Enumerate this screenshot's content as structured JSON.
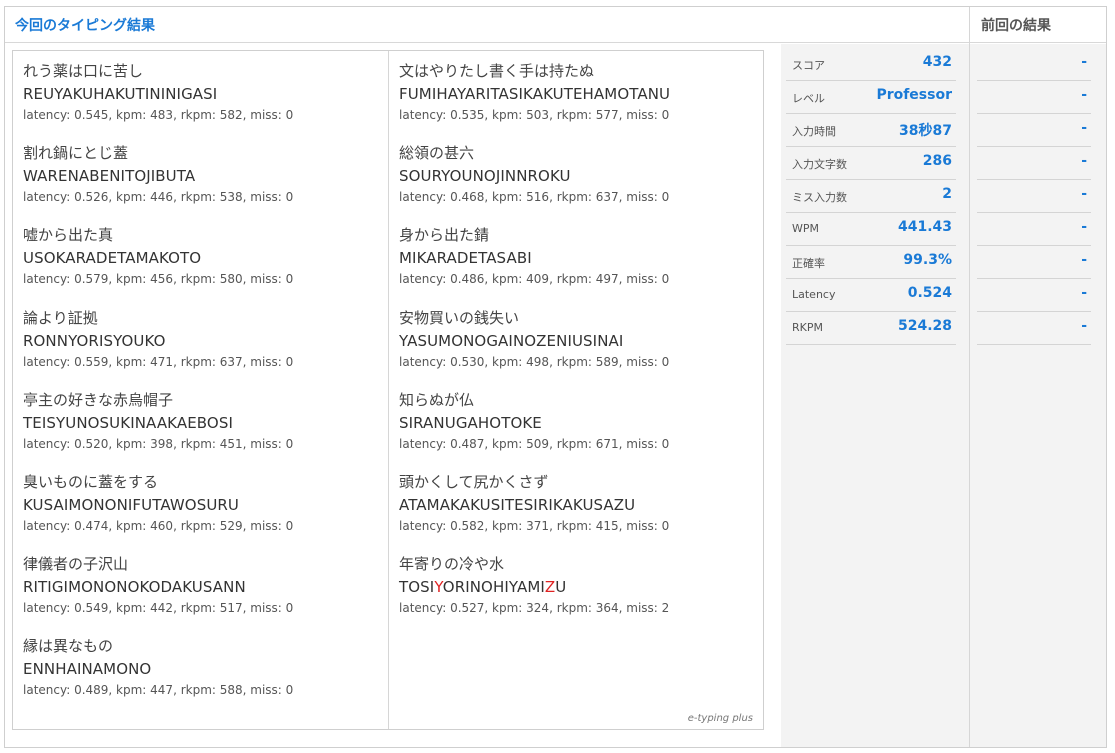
{
  "header": {
    "title": "今回のタイピング結果",
    "previous_title": "前回の結果"
  },
  "brand": "e-typing plus",
  "words": [
    {
      "jp": "れう薬は口に苦し",
      "romaji": "REUYAKUHAKUTININIGASI",
      "metric": "latency: 0.545, kpm: 483, rkpm: 582, miss: 0"
    },
    {
      "jp": "割れ鍋にとじ蓋",
      "romaji": "WARENABENITOJIBUTA",
      "metric": "latency: 0.526, kpm: 446, rkpm: 538, miss: 0"
    },
    {
      "jp": "嘘から出た真",
      "romaji": "USOKARADETAMAKOTO",
      "metric": "latency: 0.579, kpm: 456, rkpm: 580, miss: 0"
    },
    {
      "jp": "論より証拠",
      "romaji": "RONNYORISYOUKO",
      "metric": "latency: 0.559, kpm: 471, rkpm: 637, miss: 0"
    },
    {
      "jp": "亭主の好きな赤烏帽子",
      "romaji": "TEISYUNOSUKINAAKAEBOSI",
      "metric": "latency: 0.520, kpm: 398, rkpm: 451, miss: 0"
    },
    {
      "jp": "臭いものに蓋をする",
      "romaji": "KUSAIMONONIFUTAWOSURU",
      "metric": "latency: 0.474, kpm: 460, rkpm: 529, miss: 0"
    },
    {
      "jp": "律儀者の子沢山",
      "romaji": "RITIGIMONONOKODAKUSANN",
      "metric": "latency: 0.549, kpm: 442, rkpm: 517, miss: 0"
    },
    {
      "jp": "縁は異なもの",
      "romaji": "ENNHAINAMONO",
      "metric": "latency: 0.489, kpm: 447, rkpm: 588, miss: 0"
    },
    {
      "jp": "文はやりたし書く手は持たぬ",
      "romaji": "FUMIHAYARITASIKAKUTEHAMOTANU",
      "metric": "latency: 0.535, kpm: 503, rkpm: 577, miss: 0"
    },
    {
      "jp": "総領の甚六",
      "romaji": "SOURYOUNOJINNROKU",
      "metric": "latency: 0.468, kpm: 516, rkpm: 637, miss: 0"
    },
    {
      "jp": "身から出た錆",
      "romaji": "MIKARADETASABI",
      "metric": "latency: 0.486, kpm: 409, rkpm: 497, miss: 0"
    },
    {
      "jp": "安物買いの銭失い",
      "romaji": "YASUMONOGAINOZENIUSINAI",
      "metric": "latency: 0.530, kpm: 498, rkpm: 589, miss: 0"
    },
    {
      "jp": "知らぬが仏",
      "romaji": "SIRANUGAHOTOKE",
      "metric": "latency: 0.487, kpm: 509, rkpm: 671, miss: 0"
    },
    {
      "jp": "頭かくして尻かくさず",
      "romaji": "ATAMAKAKUSITESIRIKAKUSAZU",
      "metric": "latency: 0.582, kpm: 371, rkpm: 415, miss: 0"
    },
    {
      "jp": "年寄りの冷や水",
      "romaji_parts": [
        "TOSI",
        "Y",
        "ORINOHIYAMI",
        "Z",
        "U"
      ],
      "metric": "latency: 0.527, kpm: 324, rkpm: 364, miss: 2"
    }
  ],
  "stats": [
    {
      "label": "スコア",
      "value": "432"
    },
    {
      "label": "レベル",
      "value": "Professor"
    },
    {
      "label": "入力時間",
      "value": "38秒87"
    },
    {
      "label": "入力文字数",
      "value": "286"
    },
    {
      "label": "ミス入力数",
      "value": "2"
    },
    {
      "label": "WPM",
      "value": "441.43"
    },
    {
      "label": "正確率",
      "value": "99.3%"
    },
    {
      "label": "Latency",
      "value": "0.524"
    },
    {
      "label": "RKPM",
      "value": "524.28"
    }
  ],
  "previous": [
    "-",
    "-",
    "-",
    "-",
    "-",
    "-",
    "-",
    "-",
    "-"
  ],
  "colors": {
    "accent": "#1a7ad6",
    "miss": "#e02222"
  }
}
